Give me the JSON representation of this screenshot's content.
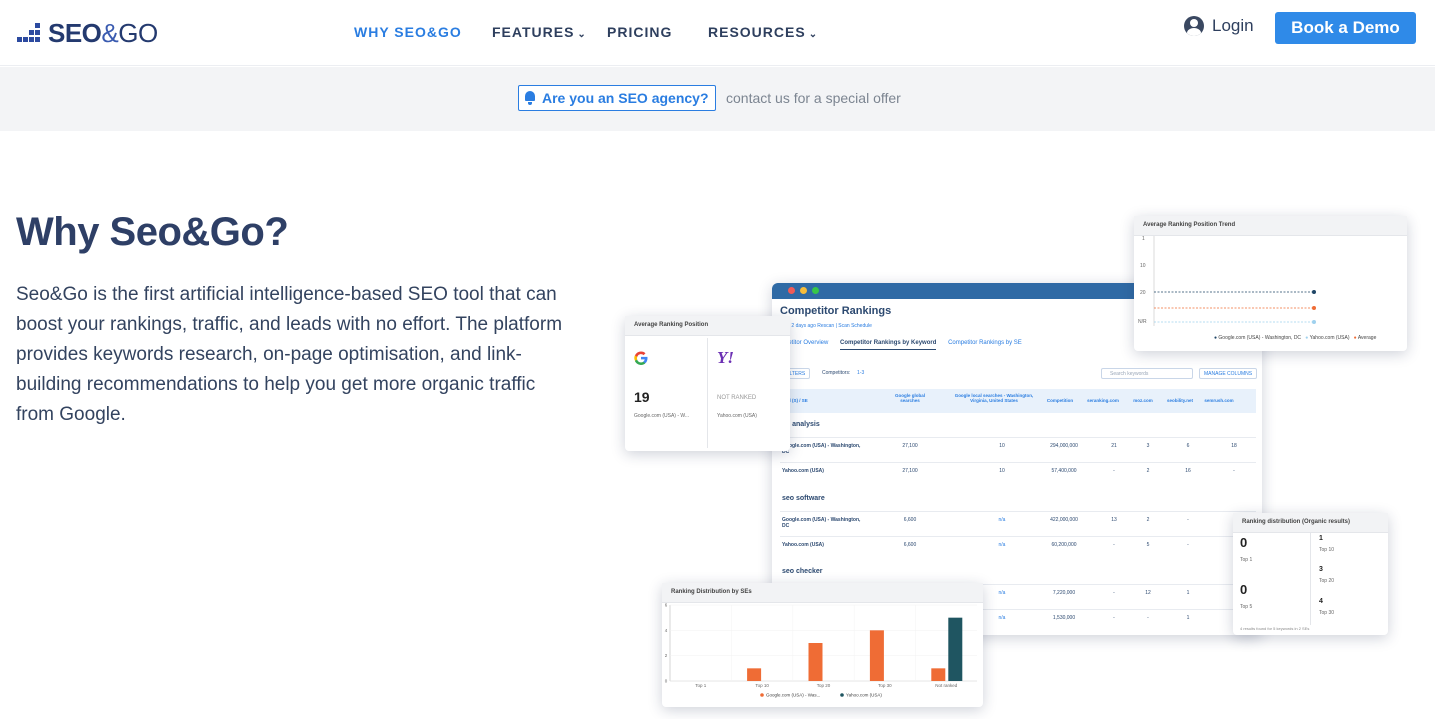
{
  "header": {
    "logo_seo": "SEO",
    "logo_amp": "&",
    "logo_go": "GO",
    "nav": [
      {
        "label": "WHY SEO&GO",
        "active": true
      },
      {
        "label": "FEATURES",
        "dropdown": true
      },
      {
        "label": "PRICING"
      },
      {
        "label": "RESOURCES",
        "dropdown": true
      }
    ],
    "login_label": "Login",
    "demo_label": "Book a Demo"
  },
  "promo": {
    "badge_label": "Are you an SEO agency?",
    "text": "contact us for a special offer"
  },
  "hero": {
    "title": "Why Seo&Go?",
    "description": "Seo&Go is the first artificial intelligence-based SEO tool that can boost your rankings, traffic, and leads with no effort. The platform provides keywords research, on-page optimisation, and link-building recommendations to help you get more organic traffic from Google."
  },
  "mockup": {
    "main": {
      "title": "Competitor Rankings",
      "subtitle": "rned 2 days ago   Rescan  |  Scan Schedule",
      "tabs": [
        "mpetitor Overview",
        "Competitor Rankings by Keyword",
        "Competitor Rankings by SE"
      ],
      "filters": "FILTERS",
      "competitors_label": "Competitors:",
      "competitors_value": "1-3",
      "search_placeholder": "Search keywords",
      "manage_columns": "MANAGE COLUMNS",
      "headers": [
        "word (S) / SE",
        "Google global searches",
        "Google local searches - Washington, Virginia, United States",
        "Competition",
        "seranking.com",
        "moz.com",
        "seobility.net",
        "semrush.com"
      ],
      "groups": [
        {
          "name": "eo analysis",
          "rows": [
            [
              "Google.com (USA) - Washington, DC",
              "27,100",
              "10",
              "294,000,000",
              "21",
              "3",
              "6",
              "18"
            ],
            [
              "Yahoo.com (USA)",
              "27,100",
              "10",
              "57,400,000",
              "-",
              "2",
              "16",
              "-"
            ]
          ]
        },
        {
          "name": "seo software",
          "rows": [
            [
              "Google.com (USA) - Washington, DC",
              "6,600",
              "n/a",
              "422,000,000",
              "13",
              "2",
              "-",
              ""
            ],
            [
              "Yahoo.com (USA)",
              "6,600",
              "n/a",
              "60,200,000",
              "-",
              "5",
              "-",
              ""
            ]
          ]
        },
        {
          "name": "seo checker",
          "rows": [
            [
              "",
              "",
              "n/a",
              "7,220,000",
              "-",
              "12",
              "1",
              ""
            ],
            [
              "",
              "",
              "n/a",
              "1,530,000",
              "-",
              "-",
              "1",
              ""
            ]
          ]
        }
      ]
    },
    "arp": {
      "title": "Average Ranking Position",
      "google_rank": "19",
      "google_label": "Google.com (USA) - W...",
      "yahoo_rank": "NOT RANKED",
      "yahoo_label": "Yahoo.com (USA)"
    },
    "trend": {
      "title": "Average Ranking Position Trend",
      "yticks": [
        "1",
        "10",
        "20",
        "N/R"
      ],
      "legend": [
        "Google.com (USA) - Washington, DC",
        "Yahoo.com (USA)",
        "Average"
      ]
    },
    "dist": {
      "title": "Ranking distribution (Organic results)",
      "cells": [
        {
          "value": "0",
          "label": "Top 1"
        },
        {
          "value": "1",
          "label": "Top 10"
        },
        {
          "value": "3",
          "label": "Top 20"
        },
        {
          "value": "0",
          "label": "Top 5"
        },
        {
          "value": "4",
          "label": "Top 30"
        }
      ],
      "footer": "4 results found for 5 keywords in 2 SEs"
    },
    "chart": {
      "title": "Ranking Distribution by SEs",
      "legend": [
        "Google.com (USA) - Was...",
        "Yahoo.com (USA)"
      ]
    }
  },
  "colors": {
    "accent": "#2a7de1",
    "button": "#2f8ae8",
    "heading": "#2e3f66",
    "google_bar": "#ef6c35",
    "yahoo_bar": "#1f5561"
  },
  "chart_data": {
    "type": "bar",
    "title": "Ranking Distribution by SEs",
    "categories": [
      "Top 1",
      "Top 10",
      "Top 20",
      "Top 30",
      "Not ranked"
    ],
    "series": [
      {
        "name": "Google.com (USA) - Was...",
        "values": [
          0,
          1,
          3,
          4,
          1
        ]
      },
      {
        "name": "Yahoo.com (USA)",
        "values": [
          0,
          0,
          0,
          0,
          5
        ]
      }
    ],
    "ylim": [
      0,
      6
    ],
    "yticks": [
      "0",
      "2",
      "4",
      "6"
    ],
    "legend": "bottom"
  }
}
